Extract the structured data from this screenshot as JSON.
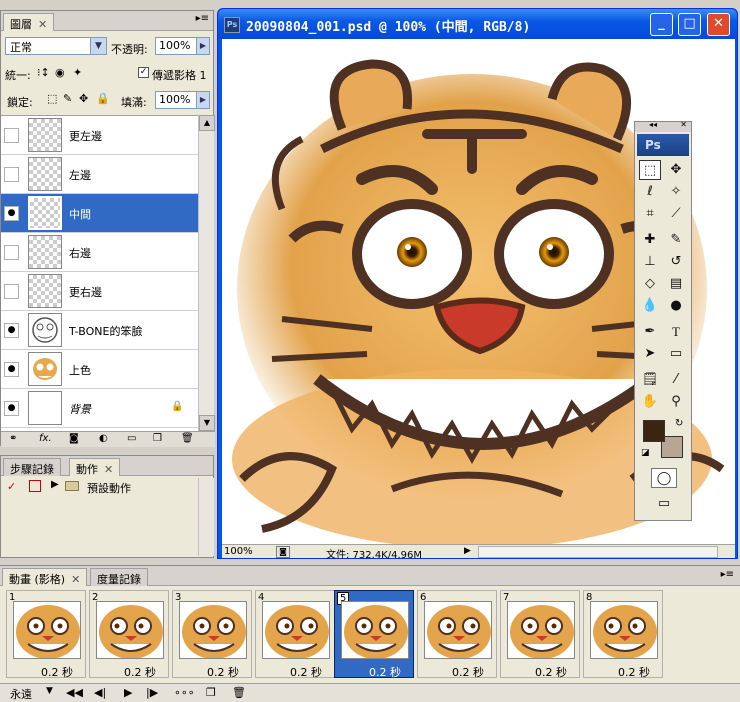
{
  "layers_panel": {
    "tab_label": "圖層",
    "tab_close": "✕",
    "blend_mode": "正常",
    "opacity_label": "不透明:",
    "opacity_value": "100%",
    "unify_label": "統一:",
    "propagate_label": "傳遞影格 1",
    "lock_label": "鎖定:",
    "fill_label": "填滿:",
    "fill_value": "100%",
    "layers": [
      {
        "name": "更左邊",
        "visible": false,
        "selected": false
      },
      {
        "name": "左邊",
        "visible": false,
        "selected": false
      },
      {
        "name": "中間",
        "visible": true,
        "selected": true
      },
      {
        "name": "右邊",
        "visible": false,
        "selected": false
      },
      {
        "name": "更右邊",
        "visible": false,
        "selected": false
      },
      {
        "name": "T-BONE的笨臉",
        "visible": true,
        "selected": false
      },
      {
        "name": "上色",
        "visible": true,
        "selected": false
      },
      {
        "name": "背景",
        "visible": true,
        "selected": false,
        "locked": true
      }
    ],
    "bottom_icons": [
      "link-icon",
      "fx-icon",
      "mask-icon",
      "adjustment-icon",
      "group-icon",
      "new-layer-icon",
      "trash-icon"
    ],
    "fx_label": "fx."
  },
  "actions_panel": {
    "tabs": [
      "步驟記錄",
      "動作"
    ],
    "tab_close": "✕",
    "set_name": "預設動作"
  },
  "document": {
    "title": "20090804_001.psd @ 100% (中間, RGB/8)",
    "zoom": "100%",
    "file_info": "文件: 732.4K/4.96M",
    "minimize": "_",
    "maximize": "□",
    "close": "✕"
  },
  "tools": {
    "logo": "Ps",
    "items": [
      "marquee",
      "move",
      "lasso",
      "magic-wand",
      "crop",
      "slice",
      "healing",
      "brush",
      "stamp",
      "history-brush",
      "eraser",
      "gradient",
      "blur",
      "dodge",
      "pen",
      "type",
      "path-select",
      "shape",
      "notes",
      "eyedropper",
      "hand",
      "zoom"
    ],
    "foreground_color": "#3b2410",
    "background_color": "#b7a693"
  },
  "animation_panel": {
    "tabs": [
      "動畫 (影格)",
      "度量記錄"
    ],
    "tab_close": "✕",
    "frames": [
      {
        "num": "1",
        "delay": "0.2 秒"
      },
      {
        "num": "2",
        "delay": "0.2 秒"
      },
      {
        "num": "3",
        "delay": "0.2 秒"
      },
      {
        "num": "4",
        "delay": "0.2 秒"
      },
      {
        "num": "5",
        "delay": "0.2 秒",
        "selected": true
      },
      {
        "num": "6",
        "delay": "0.2 秒"
      },
      {
        "num": "7",
        "delay": "0.2 秒"
      },
      {
        "num": "8",
        "delay": "0.2 秒"
      }
    ],
    "loop_label": "永遠"
  }
}
